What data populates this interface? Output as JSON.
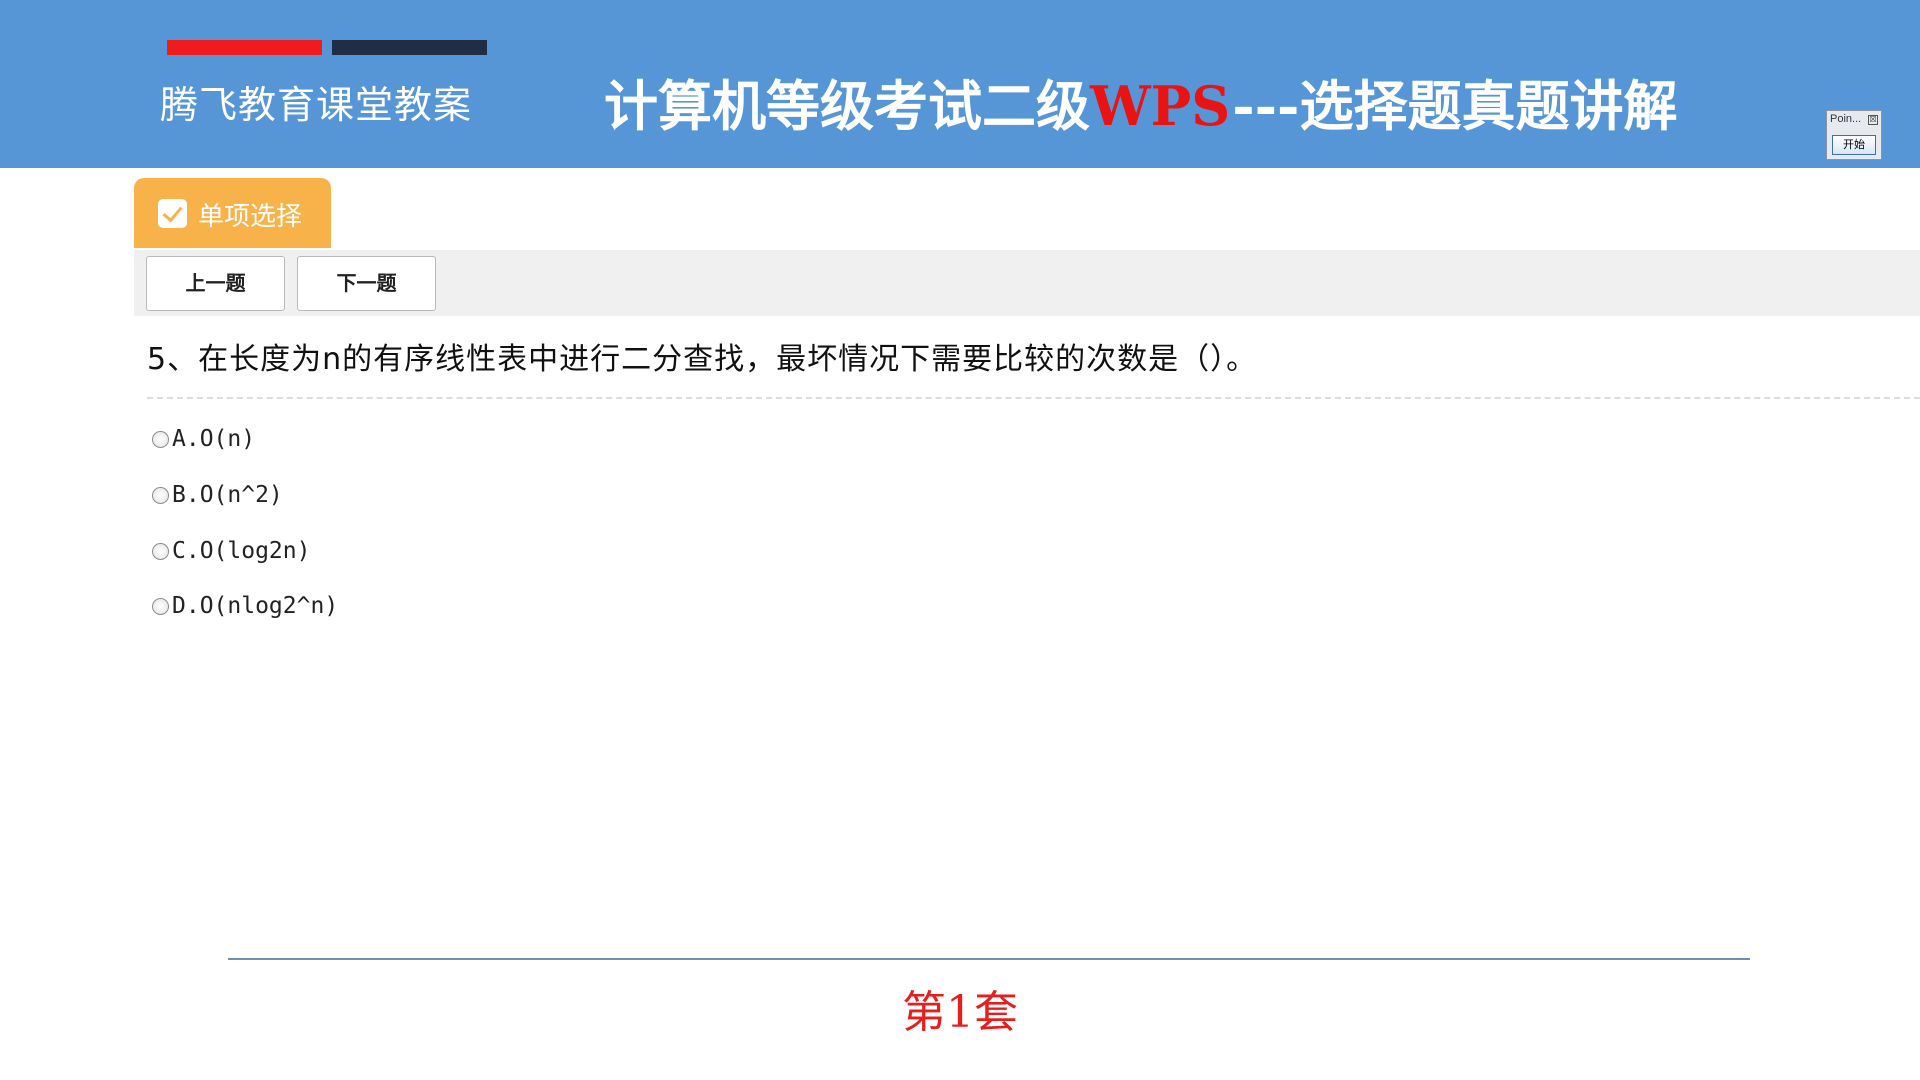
{
  "header": {
    "brand": "腾飞教育课堂教案",
    "title_prefix": "计算机等级考试二级",
    "title_accent": "WPS",
    "title_suffix": "---选择题真题讲解"
  },
  "widget": {
    "title": "Poin...",
    "close": "☒",
    "start_label": "开始"
  },
  "question_panel": {
    "tab_label": "单项选择",
    "prev_label": "上一题",
    "next_label": "下一题",
    "question": "5、在长度为n的有序线性表中进行二分查找，最坏情况下需要比较的次数是（）。",
    "options": [
      {
        "label": "A.O(n)"
      },
      {
        "label": "B.O(n^2)"
      },
      {
        "label": "C.O(log2n)"
      },
      {
        "label": "D.O(nlog2^n)"
      }
    ]
  },
  "footer": {
    "set_label": "第1套"
  },
  "colors": {
    "header_bg": "#5696d6",
    "accent_red": "#e81414",
    "tab_orange": "#f8b24a",
    "bar_navy": "#1f2d46"
  }
}
